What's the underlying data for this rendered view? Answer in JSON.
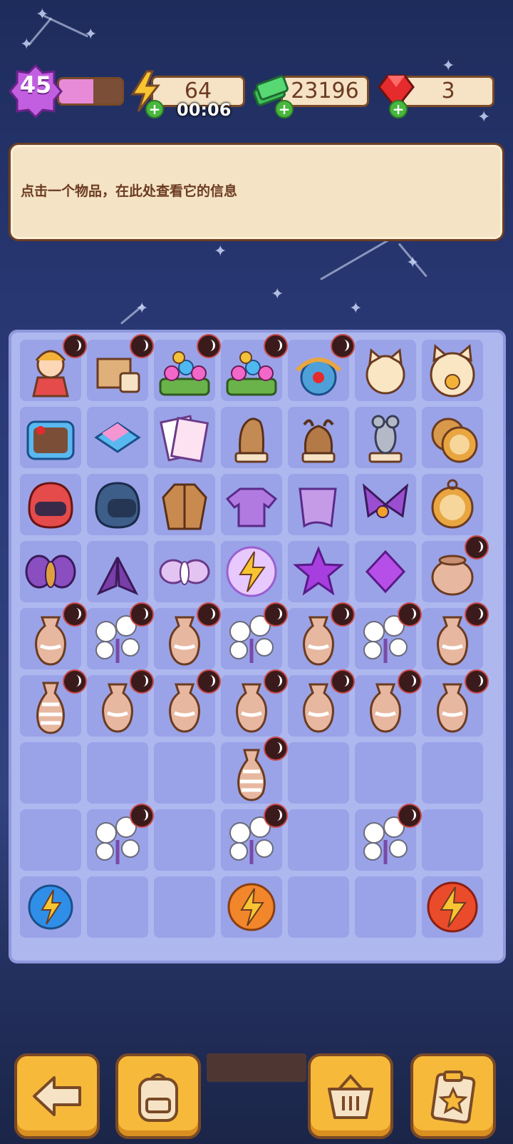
{
  "hud": {
    "level": "45",
    "level_progress": 0.55,
    "energy": "64",
    "energy_timer": "00:06",
    "cash": "23196",
    "gems": "3"
  },
  "info_panel": {
    "text": "点击一个物品，在此处查看它的信息"
  },
  "board": {
    "rows": [
      [
        "girl-character",
        "wooden-crate",
        "flower-bed",
        "flower-bed",
        "dragon-vase",
        "lucky-cat",
        "lucky-cat-large"
      ],
      [
        "lunch-box",
        "soap-box",
        "test-papers",
        "llama-figurine",
        "yak-figurine",
        "mouse-figurine",
        "pocket-watch-open"
      ],
      [
        "red-helmet",
        "blue-helmet",
        "brown-coat",
        "purple-sweater",
        "purple-cloth",
        "butterfly",
        "pocket-watch"
      ],
      [
        "moth-purple",
        "moth-dark",
        "moth-pale",
        "energy-orb",
        "purple-star",
        "purple-gem",
        "clay-pot"
      ],
      [
        "vase",
        "cotton-plant",
        "vase",
        "cotton-plant",
        "vase",
        "cotton-plant",
        "vase"
      ],
      [
        "striped-vase",
        "vase",
        "vase",
        "vase",
        "vase",
        "vase",
        "vase"
      ],
      [
        "",
        "",
        "",
        "striped-vase",
        "",
        "",
        ""
      ],
      [
        "",
        "cotton-plant",
        "",
        "cotton-plant",
        "",
        "cotton-plant",
        ""
      ],
      [
        "energy-blue",
        "",
        "",
        "energy-orange",
        "",
        "",
        "energy-red"
      ]
    ],
    "locked": [
      [
        true,
        true,
        true,
        true,
        true,
        false,
        false
      ],
      [
        false,
        false,
        false,
        false,
        false,
        false,
        false
      ],
      [
        false,
        false,
        false,
        false,
        false,
        false,
        false
      ],
      [
        false,
        false,
        false,
        false,
        false,
        false,
        true
      ],
      [
        true,
        true,
        true,
        true,
        true,
        true,
        true
      ],
      [
        true,
        true,
        true,
        true,
        true,
        true,
        true
      ],
      [
        false,
        false,
        false,
        true,
        false,
        false,
        false
      ],
      [
        false,
        true,
        false,
        true,
        false,
        true,
        false
      ],
      [
        false,
        false,
        false,
        false,
        false,
        false,
        false
      ]
    ]
  },
  "footer": [
    "back-arrow-icon",
    "backpack-icon",
    "basket-icon",
    "clipboard-star-icon"
  ],
  "colors": {
    "accent": "#f6b93a",
    "border": "#7a4a27",
    "board": "#aeb7ee",
    "cell": "#9aa3e8"
  }
}
